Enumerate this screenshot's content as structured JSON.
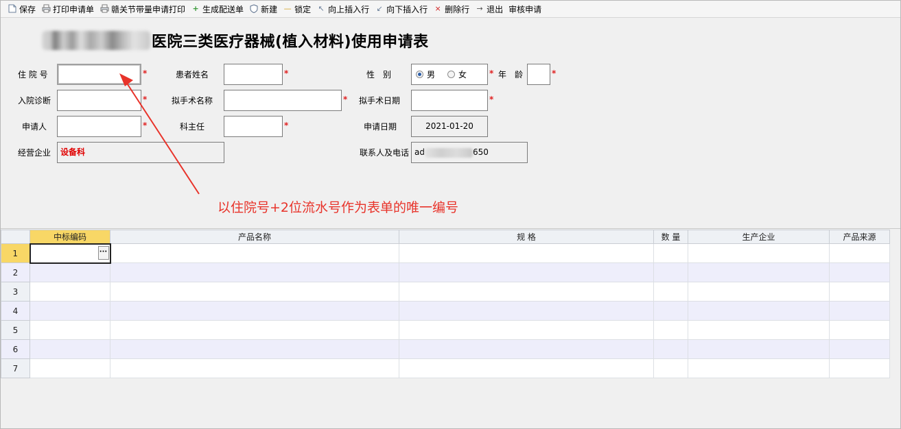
{
  "toolbar": {
    "items": [
      {
        "label": "保存",
        "icon": "save-icon"
      },
      {
        "label": "打印申请单",
        "icon": "printer-icon"
      },
      {
        "label": "赣关节带量申请打印",
        "icon": "printer-icon"
      },
      {
        "label": "生成配送单",
        "icon": "plus-icon"
      },
      {
        "label": "新建",
        "icon": "shield-icon"
      },
      {
        "label": "锁定",
        "icon": "lock-icon"
      },
      {
        "label": "向上插入行",
        "icon": "insert-up-icon"
      },
      {
        "label": "向下插入行",
        "icon": "insert-down-icon"
      },
      {
        "label": "删除行",
        "icon": "delete-icon"
      },
      {
        "label": "退出",
        "icon": "exit-icon"
      },
      {
        "label": "审核申请",
        "icon": ""
      }
    ]
  },
  "form": {
    "title": "医院三类医疗器械(植入材料)使用申请表",
    "labels": {
      "admission_no": "住 院 号",
      "patient_name": "患者姓名",
      "gender": "性　别",
      "age": "年　龄",
      "diagnosis": "入院诊断",
      "surgery_name": "拟手术名称",
      "surgery_date": "拟手术日期",
      "applicant": "申请人",
      "director": "科主任",
      "apply_date": "申请日期",
      "company": "经营企业",
      "contact": "联系人及电话"
    },
    "values": {
      "admission_no": "",
      "patient_name": "",
      "age": "",
      "diagnosis": "",
      "surgery_name": "",
      "surgery_date": "",
      "applicant": "",
      "director": "",
      "apply_date": "2021-01-20",
      "company": "设备科",
      "contact_prefix": "ad",
      "contact_suffix": "650"
    },
    "gender_options": [
      {
        "label": "男",
        "selected": true
      },
      {
        "label": "女",
        "selected": false
      }
    ],
    "required_mark": "*"
  },
  "annotation": {
    "text": "以住院号+2位流水号作为表单的唯一编号",
    "color": "#e8332a"
  },
  "grid": {
    "columns": [
      "中标编码",
      "产品名称",
      "规 格",
      "数 量",
      "生产企业",
      "产品来源"
    ],
    "rows": [
      {
        "num": "1",
        "cells": [
          "",
          "",
          "",
          "",
          "",
          ""
        ]
      },
      {
        "num": "2",
        "cells": [
          "",
          "",
          "",
          "",
          "",
          ""
        ]
      },
      {
        "num": "3",
        "cells": [
          "",
          "",
          "",
          "",
          "",
          ""
        ]
      },
      {
        "num": "4",
        "cells": [
          "",
          "",
          "",
          "",
          "",
          ""
        ]
      },
      {
        "num": "5",
        "cells": [
          "",
          "",
          "",
          "",
          "",
          ""
        ]
      },
      {
        "num": "6",
        "cells": [
          "",
          "",
          "",
          "",
          "",
          ""
        ]
      },
      {
        "num": "7",
        "cells": [
          "",
          "",
          "",
          "",
          "",
          ""
        ]
      }
    ],
    "ellipsis_label": "···"
  }
}
